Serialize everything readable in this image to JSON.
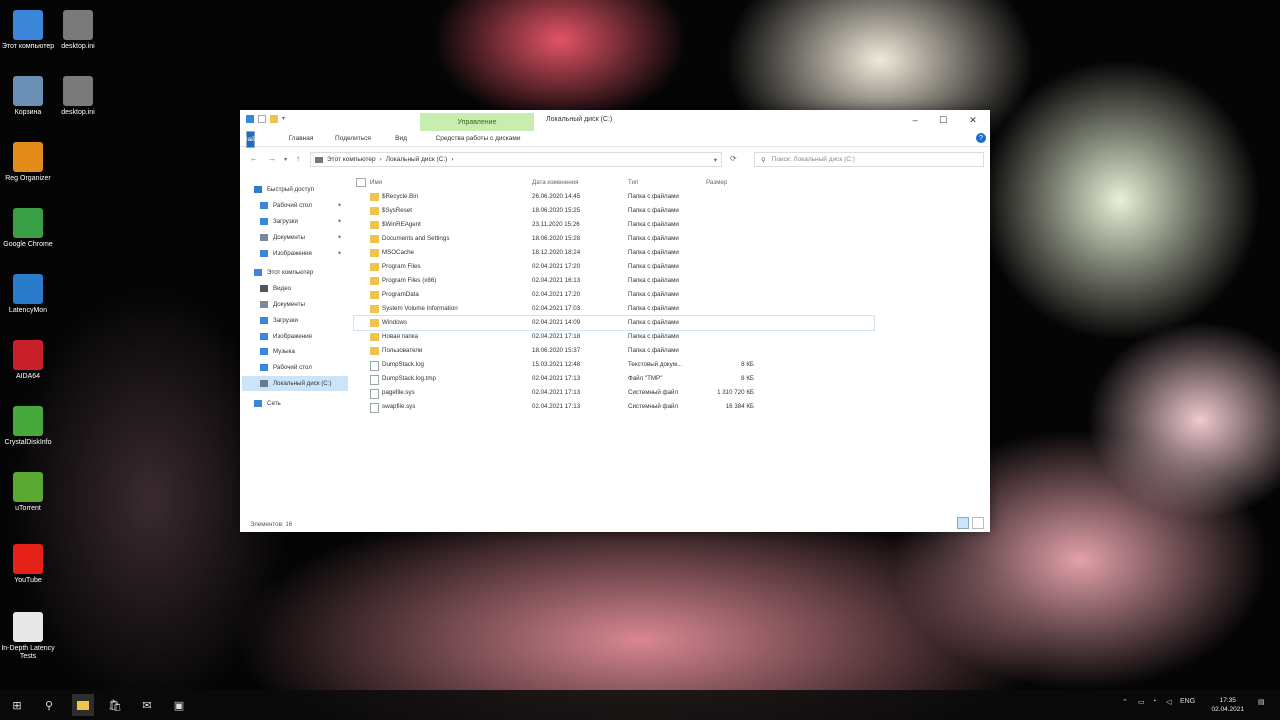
{
  "desktop": {
    "icons": [
      {
        "label": "Этот компьютер",
        "icon": "computer-icon",
        "color": "#3b86d8"
      },
      {
        "label": "desktop.ini",
        "icon": "ini-file-icon",
        "color": "#7a7a7a"
      },
      {
        "label": "Корзина",
        "icon": "recycle-bin-icon",
        "color": "#6b8fb5"
      },
      {
        "label": "desktop.ini",
        "icon": "ini-file-icon",
        "color": "#7a7a7a"
      },
      {
        "label": "Reg Organizer",
        "icon": "reg-organizer-icon",
        "color": "#e38c1c"
      },
      {
        "label": "Google Chrome",
        "icon": "chrome-icon",
        "color": "#3a9e45"
      },
      {
        "label": "LatencyMon",
        "icon": "latencymon-icon",
        "color": "#2a7bc9"
      },
      {
        "label": "AIDA64",
        "icon": "aida64-icon",
        "color": "#c8202b"
      },
      {
        "label": "CrystalDiskInfo",
        "icon": "crystaldiskinfo-icon",
        "color": "#47a83e"
      },
      {
        "label": "uTorrent",
        "icon": "utorrent-icon",
        "color": "#5aa832"
      },
      {
        "label": "YouTube",
        "icon": "youtube-icon",
        "color": "#e62117"
      },
      {
        "label": "In-Depth Latency Tests",
        "icon": "document-icon",
        "color": "#e8e8e8"
      }
    ]
  },
  "window": {
    "manage_tab": "Управление",
    "title": "Локальный диск (C:)",
    "tabs": [
      "Файл",
      "Главная",
      "Поделиться",
      "Вид"
    ],
    "contextual_tab": "Средства работы с дисками",
    "address": {
      "parts": [
        "Этот компьютер",
        "›",
        "Локальный диск (C:)",
        "›"
      ]
    },
    "search_placeholder": "Поиск: Локальный диск (C:)",
    "nav_pane": [
      {
        "label": "Быстрый доступ",
        "icon": "star-icon",
        "color": "#2a7bd6",
        "pinned": false
      },
      {
        "label": "Рабочий стол",
        "icon": "desktop-icon",
        "color": "#3b86d8",
        "pinned": true
      },
      {
        "label": "Загрузки",
        "icon": "downloads-icon",
        "color": "#3b86d8",
        "pinned": true
      },
      {
        "label": "Документы",
        "icon": "documents-icon",
        "color": "#7a8a9a",
        "pinned": true
      },
      {
        "label": "Изображения",
        "icon": "pictures-icon",
        "color": "#3b86d8",
        "pinned": true
      },
      {
        "label": "Этот компьютер",
        "icon": "computer-icon",
        "color": "#3b86d8",
        "pinned": false
      },
      {
        "label": "Видео",
        "icon": "video-icon",
        "color": "#555555",
        "pinned": false
      },
      {
        "label": "Документы",
        "icon": "documents-icon",
        "color": "#7a8a9a",
        "pinned": false
      },
      {
        "label": "Загрузки",
        "icon": "downloads-icon",
        "color": "#3b86d8",
        "pinned": false
      },
      {
        "label": "Изображения",
        "icon": "pictures-icon",
        "color": "#3b86d8",
        "pinned": false
      },
      {
        "label": "Музыка",
        "icon": "music-icon",
        "color": "#3b86d8",
        "pinned": false
      },
      {
        "label": "Рабочий стол",
        "icon": "desktop-icon",
        "color": "#3b86d8",
        "pinned": false
      },
      {
        "label": "Локальный диск (C:)",
        "icon": "drive-icon",
        "color": "#6a7a8a",
        "pinned": false,
        "selected": true
      },
      {
        "label": "Сеть",
        "icon": "network-icon",
        "color": "#3b86d8",
        "pinned": false
      }
    ],
    "columns": [
      "Имя",
      "Дата изменения",
      "Тип",
      "Размер"
    ],
    "rows": [
      {
        "name": "$Recycle.Bin",
        "date": "26.06.2020 14:45",
        "type": "Папка с файлами",
        "size": "",
        "kind": "folder"
      },
      {
        "name": "$SysReset",
        "date": "18.06.2020 15:25",
        "type": "Папка с файлами",
        "size": "",
        "kind": "folder"
      },
      {
        "name": "$WinREAgent",
        "date": "23.11.2020 15:26",
        "type": "Папка с файлами",
        "size": "",
        "kind": "folder"
      },
      {
        "name": "Documents and Settings",
        "date": "18.06.2020 15:28",
        "type": "Папка с файлами",
        "size": "",
        "kind": "folder"
      },
      {
        "name": "MSOCache",
        "date": "18.12.2020 18:24",
        "type": "Папка с файлами",
        "size": "",
        "kind": "folder"
      },
      {
        "name": "Program Files",
        "date": "02.04.2021 17:20",
        "type": "Папка с файлами",
        "size": "",
        "kind": "folder"
      },
      {
        "name": "Program Files (x86)",
        "date": "02.04.2021 16:13",
        "type": "Папка с файлами",
        "size": "",
        "kind": "folder"
      },
      {
        "name": "ProgramData",
        "date": "02.04.2021 17:20",
        "type": "Папка с файлами",
        "size": "",
        "kind": "folder"
      },
      {
        "name": "System Volume Information",
        "date": "02.04.2021 17:03",
        "type": "Папка с файлами",
        "size": "",
        "kind": "folder"
      },
      {
        "name": "Windows",
        "date": "02.04.2021 14:09",
        "type": "Папка с файлами",
        "size": "",
        "kind": "folder",
        "highlight": true
      },
      {
        "name": "Новая папка",
        "date": "02.04.2021 17:18",
        "type": "Папка с файлами",
        "size": "",
        "kind": "folder"
      },
      {
        "name": "Пользователи",
        "date": "18.06.2020 15:37",
        "type": "Папка с файлами",
        "size": "",
        "kind": "folder"
      },
      {
        "name": "DumpStack.log",
        "date": "15.03.2021 12:48",
        "type": "Текстовый докум...",
        "size": "8 КБ",
        "kind": "file"
      },
      {
        "name": "DumpStack.log.tmp",
        "date": "02.04.2021 17:13",
        "type": "Файл \"TMP\"",
        "size": "8 КБ",
        "kind": "file"
      },
      {
        "name": "pagefile.sys",
        "date": "02.04.2021 17:13",
        "type": "Системный файл",
        "size": "1 310 720 КБ",
        "kind": "file"
      },
      {
        "name": "swapfile.sys",
        "date": "02.04.2021 17:13",
        "type": "Системный файл",
        "size": "16 384 КБ",
        "kind": "file"
      }
    ],
    "status_text": "Элементов: 16"
  },
  "taskbar": {
    "lang": "ENG",
    "time": "17:35",
    "date": "02.04.2021"
  }
}
